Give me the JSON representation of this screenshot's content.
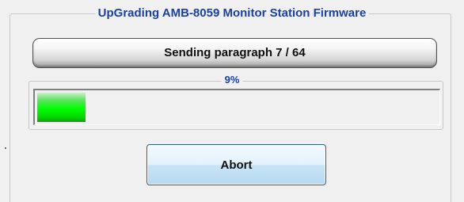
{
  "dialog": {
    "group_title": "UpGrading AMB-8059 Monitor Station Firmware",
    "status_text": "Sending paragraph 7 / 64",
    "progress": {
      "label": "9%",
      "fraction": 0.12
    },
    "abort_label": "Abort"
  },
  "colors": {
    "accent_title": "#1a3fa8",
    "progress_fill": "#00ff00",
    "background": "#f0f0f0"
  }
}
